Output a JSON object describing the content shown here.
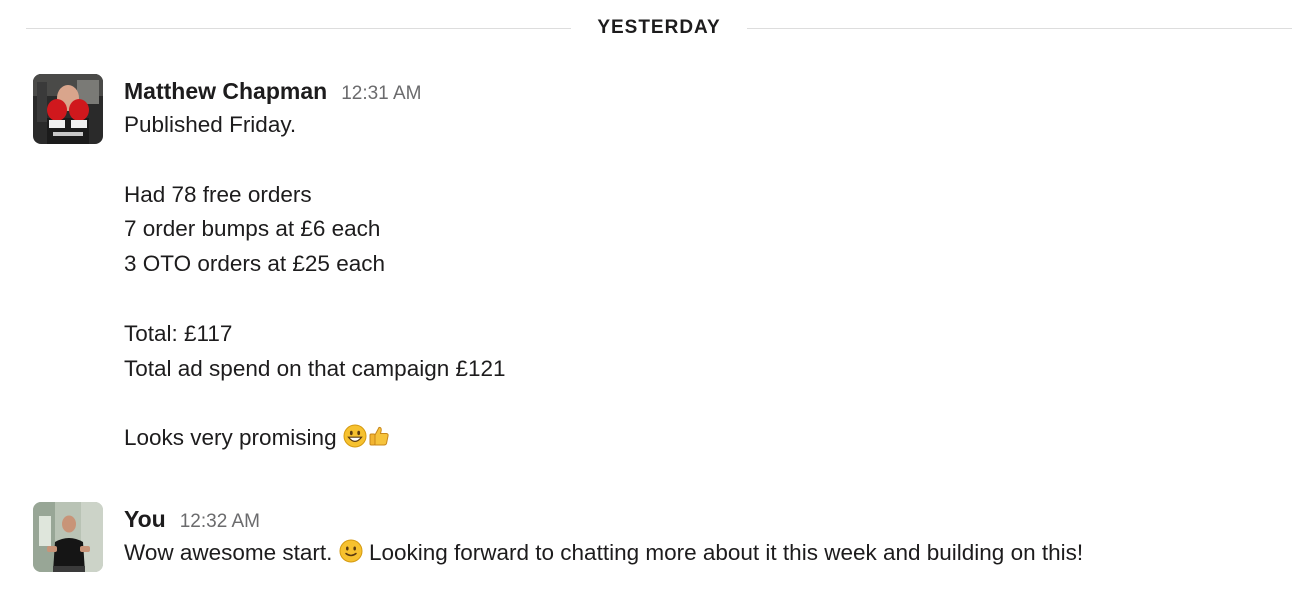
{
  "divider": {
    "label": "YESTERDAY"
  },
  "messages": [
    {
      "sender": "Matthew Chapman",
      "time": "12:31 AM",
      "avatar_icon": "boxer-photo-avatar",
      "lines": [
        "Published Friday.",
        "",
        "Had 78 free orders",
        "7 order bumps at £6 each",
        "3 OTO orders at £25 each",
        "",
        "Total: £117",
        "Total ad spend on that campaign £121",
        "",
        "Looks very promising"
      ],
      "emojis": [
        "grinning-face-emoji",
        "thumbs-up-emoji"
      ]
    },
    {
      "sender": "You",
      "time": "12:32 AM",
      "avatar_icon": "presenter-photo-avatar",
      "text_before": "Wow awesome start.",
      "emoji": "slightly-smiling-face-emoji",
      "text_after": "Looking forward to chatting more about it this week and building on this!"
    }
  ]
}
